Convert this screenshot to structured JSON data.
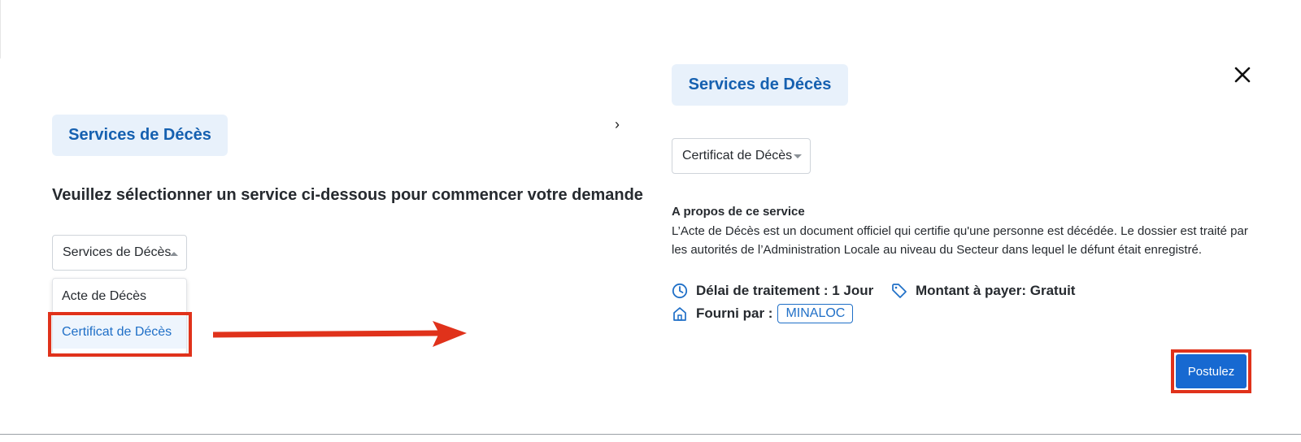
{
  "left_panel": {
    "header_label": "Services de Décès",
    "instruction": "Veuillez sélectionner un service ci-dessous pour commencer votre demande",
    "select_value": "Services de Décès",
    "options": [
      "Acte de Décès",
      "Certificat de Décès"
    ],
    "highlighted_option": "Certificat de Décès"
  },
  "right_panel": {
    "header_label": "Services de Décès",
    "select_value": "Certificat de Décès",
    "about_title": "A propos de ce service",
    "about_text": "L’Acte de Décès est un document officiel qui certifie qu'une personne est décédée. Le dossier est traité par les autorités de l’Administration Locale au niveau du Secteur dans lequel le défunt était enregistré.",
    "processing_time": "Délai de traitement : 1 Jour",
    "fee": "Montant à payer: Gratuit",
    "provided_by_label": "Fourni par :",
    "provider": "MINALOC",
    "apply_label": "Postulez"
  },
  "icons": {
    "close": "close-icon",
    "clock": "clock-icon",
    "tag": "tag-icon",
    "home": "home-icon",
    "arrow": "arrow-right-icon"
  },
  "colors": {
    "accent": "#1769d1",
    "pill_bg": "#e8f1fb",
    "pill_text": "#1560b0",
    "highlight": "#e0321b"
  }
}
